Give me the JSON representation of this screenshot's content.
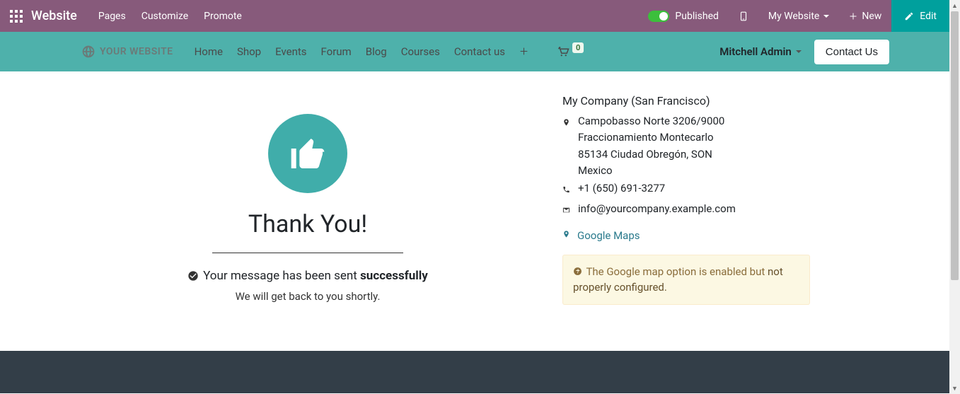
{
  "admin": {
    "brand": "Website",
    "menu": [
      "Pages",
      "Customize",
      "Promote"
    ],
    "published_label": "Published",
    "site_selector": "My Website",
    "new_label": "New",
    "edit_label": "Edit"
  },
  "header": {
    "logo_text": "YOUR WEBSITE",
    "nav": [
      "Home",
      "Shop",
      "Events",
      "Forum",
      "Blog",
      "Courses",
      "Contact us"
    ],
    "cart_count": "0",
    "user": "Mitchell Admin",
    "contact_btn": "Contact Us"
  },
  "thankyou": {
    "headline": "Thank You!",
    "msg_prefix": "Your message has been sent ",
    "msg_bold": "successfully",
    "sub": "We will get back to you shortly."
  },
  "company": {
    "name": "My Company (San Francisco)",
    "address_l1": "Campobasso Norte 3206/9000",
    "address_l2": "Fraccionamiento Montecarlo",
    "address_l3": "85134 Ciudad Obregón, SON",
    "address_l4": "Mexico",
    "phone": "+1 (650) 691-3277",
    "email": "info@yourcompany.example.com",
    "gmaps_label": "Google Maps"
  },
  "warning": {
    "text_prefix": "The Google map option is enabled but ",
    "link_text": "not properly configured."
  }
}
